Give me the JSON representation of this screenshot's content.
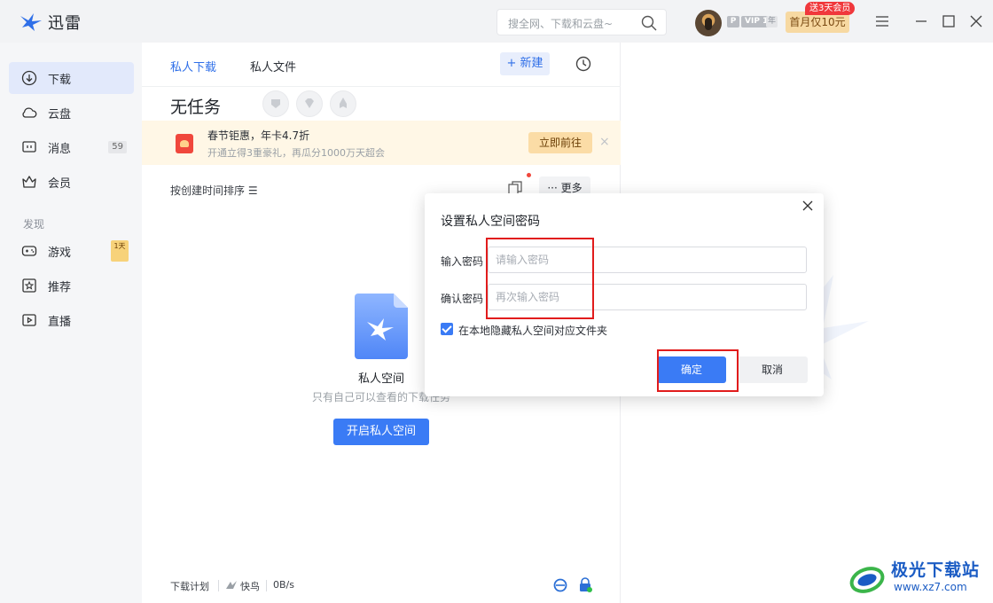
{
  "app": {
    "title": "迅雷"
  },
  "titlebar": {
    "search_placeholder": "搜全网、下载和云盘~",
    "badge_p": "P",
    "badge_vip": "VIP 1",
    "badge_year": "年",
    "promo_tag": "送3天会员",
    "promo_button": "首月仅10元"
  },
  "sidebar": {
    "items": [
      {
        "label": "下载",
        "icon": "download-icon"
      },
      {
        "label": "云盘",
        "icon": "cloud-icon"
      },
      {
        "label": "消息",
        "icon": "message-icon",
        "count": "59"
      },
      {
        "label": "会员",
        "icon": "crown-icon"
      }
    ],
    "section_title": "发现",
    "discover": [
      {
        "label": "游戏",
        "icon": "gamepad-icon",
        "badge": "1天"
      },
      {
        "label": "推荐",
        "icon": "star-icon"
      },
      {
        "label": "直播",
        "icon": "live-icon"
      }
    ]
  },
  "main": {
    "tabs": [
      {
        "label": "私人下载"
      },
      {
        "label": "私人文件"
      }
    ],
    "new_button": "+ 新建",
    "no_task": "无任务",
    "banner": {
      "title": "春节钜惠，年卡4.7折",
      "subtitle": "开通立得3重豪礼，再瓜分1000万天超会",
      "button": "立即前往",
      "close": "×"
    },
    "sort_label": "按创建时间排序 ☰",
    "more_button": "··· 更多",
    "private_title": "私人空间",
    "private_sub": "只有自己可以查看的下载任务",
    "open_button": "开启私人空间",
    "footer": {
      "plan": "下载计划",
      "speed_mode": "快鸟",
      "speed": "0B/s"
    }
  },
  "dialog": {
    "title": "设置私人空间密码",
    "password_label": "输入密码",
    "password_placeholder": "请输入密码",
    "confirm_label": "确认密码",
    "confirm_placeholder": "再次输入密码",
    "checkbox_label": "在本地隐藏私人空间对应文件夹",
    "checkbox_checked": true,
    "ok_button": "确定",
    "cancel_button": "取消"
  },
  "watermark": {
    "name": "极光下载站",
    "url": "www.xz7.com"
  },
  "colors": {
    "accent": "#3a7bf5",
    "highlight": "#e11c1c",
    "banner_bg": "#fff7e6"
  }
}
